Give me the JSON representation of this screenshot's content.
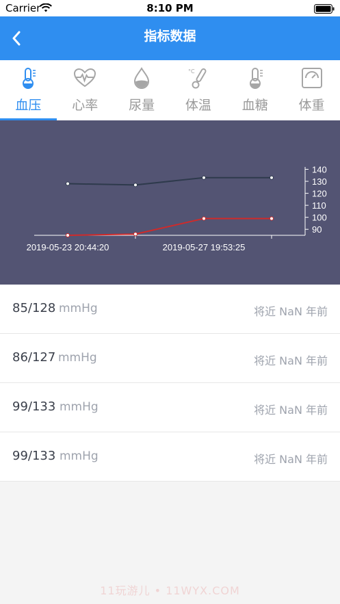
{
  "status": {
    "carrier": "Carrier",
    "time": "8:10 PM"
  },
  "nav": {
    "title": "指标数据",
    "back_icon": "chevron-left-icon"
  },
  "tabs": [
    {
      "label": "血压",
      "icon": "thermometer-icon",
      "active": true
    },
    {
      "label": "心率",
      "icon": "heart-pulse-icon",
      "active": false
    },
    {
      "label": "尿量",
      "icon": "drop-icon",
      "active": false
    },
    {
      "label": "体温",
      "icon": "celsius-thermometer-icon",
      "active": false
    },
    {
      "label": "血糖",
      "icon": "thermometer-icon",
      "active": false
    },
    {
      "label": "体重",
      "icon": "scale-icon",
      "active": false
    }
  ],
  "chart_data": {
    "type": "line",
    "x_labels": [
      "2019-05-23 20:44:20",
      "2019-05-27 19:53:25"
    ],
    "y_ticks": [
      90,
      100,
      110,
      120,
      130,
      140
    ],
    "ylim": [
      85,
      142
    ],
    "series": [
      {
        "values": [
          128,
          127,
          133,
          133
        ],
        "color": "#2e3a4c"
      },
      {
        "values": [
          85,
          86,
          99,
          99
        ],
        "color": "#d02a2a"
      }
    ],
    "background": "#535473"
  },
  "records": [
    {
      "value": "85/128",
      "unit": "mmHg",
      "time": "将近 NaN 年前"
    },
    {
      "value": "86/127",
      "unit": "mmHg",
      "time": "将近 NaN 年前"
    },
    {
      "value": "99/133",
      "unit": "mmHg",
      "time": "将近 NaN 年前"
    },
    {
      "value": "99/133",
      "unit": "mmHg",
      "time": "将近 NaN 年前"
    }
  ],
  "watermark": "11玩游儿 • 11WYX.COM",
  "colors": {
    "accent": "#2f8ef0",
    "chart_bg": "#535473"
  }
}
